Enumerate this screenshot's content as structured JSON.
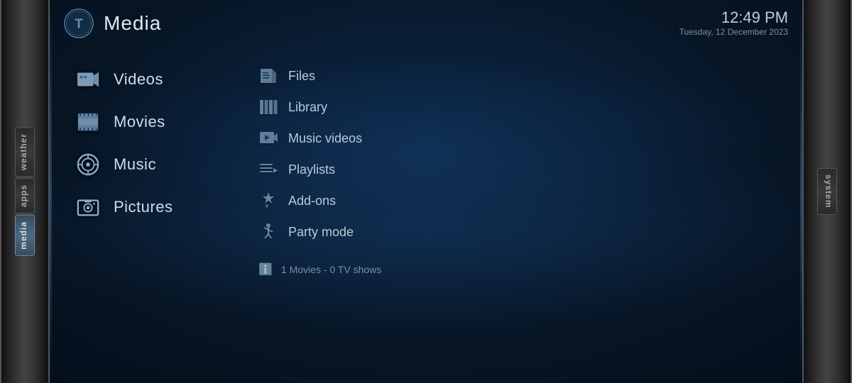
{
  "header": {
    "title": "Media",
    "time": "12:49 PM",
    "date": "Tuesday, 12 December 2023"
  },
  "left_tabs": [
    {
      "id": "weather",
      "label": "weather",
      "active": false
    },
    {
      "id": "apps",
      "label": "apps",
      "active": false
    },
    {
      "id": "media",
      "label": "media",
      "active": true
    }
  ],
  "right_tab": {
    "id": "system",
    "label": "system"
  },
  "nav_items": [
    {
      "id": "videos",
      "label": "Videos",
      "icon": "🎥"
    },
    {
      "id": "movies",
      "label": "Movies",
      "icon": "🎞"
    },
    {
      "id": "music",
      "label": "Music",
      "icon": "🎵"
    },
    {
      "id": "pictures",
      "label": "Pictures",
      "icon": "📷"
    }
  ],
  "sub_items": [
    {
      "id": "files",
      "label": "Files"
    },
    {
      "id": "library",
      "label": "Library"
    },
    {
      "id": "music-videos",
      "label": "Music videos"
    },
    {
      "id": "playlists",
      "label": "Playlists"
    },
    {
      "id": "add-ons",
      "label": "Add-ons"
    },
    {
      "id": "party-mode",
      "label": "Party mode"
    }
  ],
  "info": {
    "text": "1 Movies  -  0 TV shows"
  }
}
